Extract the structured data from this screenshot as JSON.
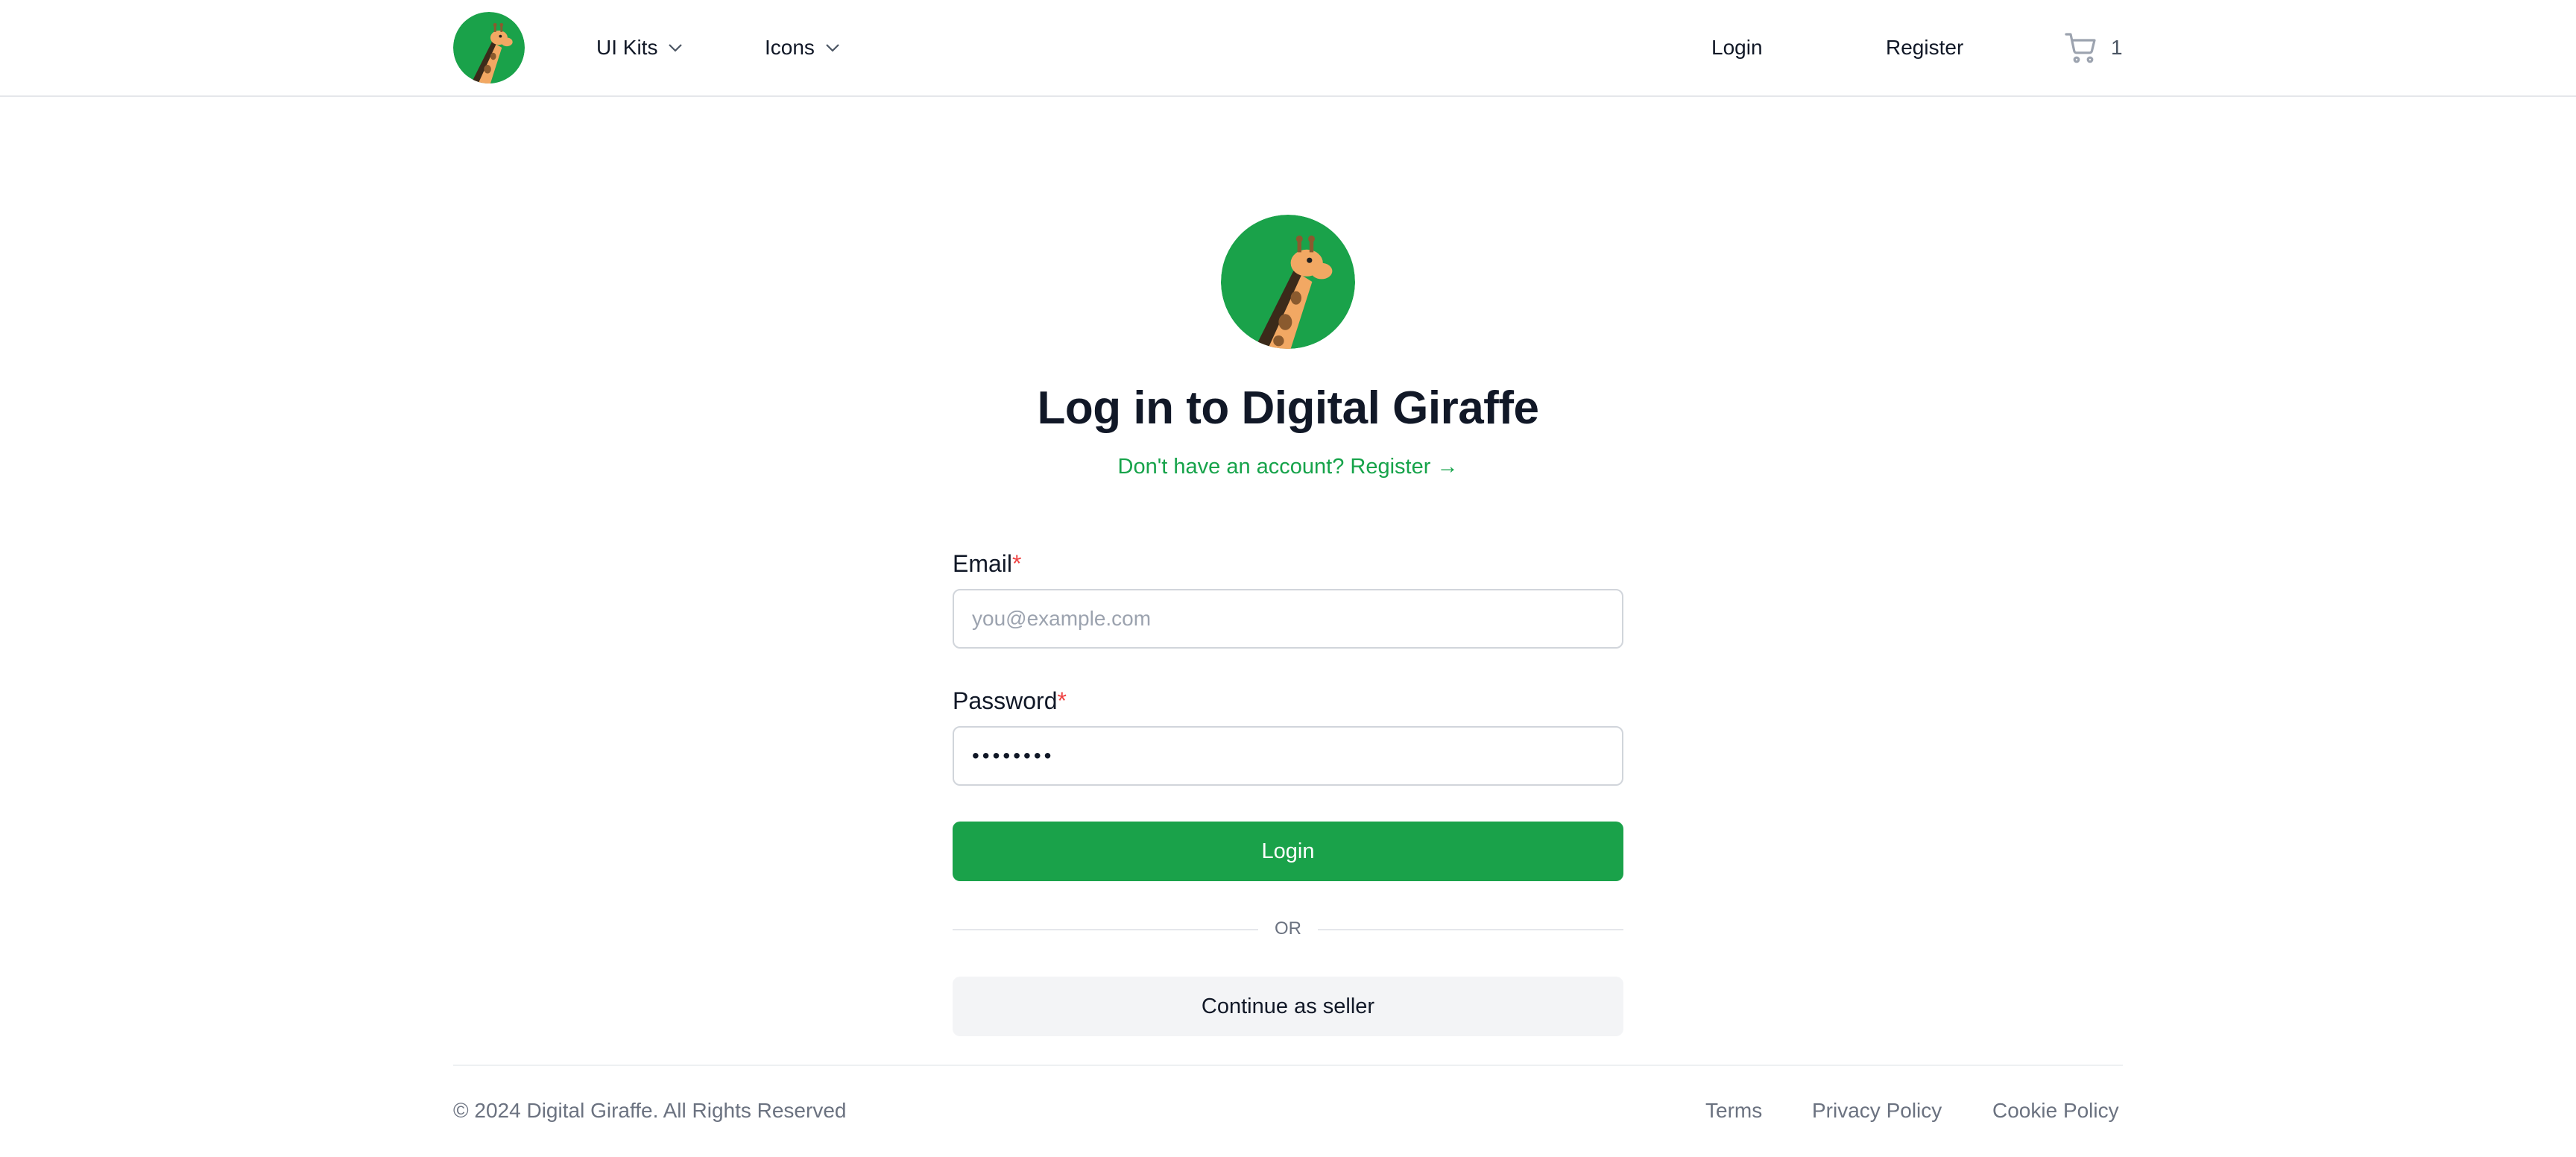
{
  "header": {
    "logo_alt": "Digital Giraffe logo",
    "nav": [
      {
        "label": "UI Kits",
        "icon": "chevron-down-icon"
      },
      {
        "label": "Icons",
        "icon": "chevron-down-icon"
      }
    ],
    "login_label": "Login",
    "register_label": "Register",
    "cart_icon": "cart-icon",
    "cart_count": "1"
  },
  "main": {
    "title": "Log in to Digital Giraffe",
    "register_prompt": "Don't have an account? Register →",
    "email_label": "Email",
    "email_placeholder": "you@example.com",
    "email_value": "",
    "password_label": "Password",
    "password_value": "••••••••",
    "required_marker": "*",
    "login_button": "Login",
    "divider_text": "OR",
    "seller_button": "Continue as seller"
  },
  "footer": {
    "copyright": "© 2024 Digital Giraffe. All Rights Reserved",
    "links": [
      "Terms",
      "Privacy Policy",
      "Cookie Policy"
    ]
  },
  "colors": {
    "brand_green": "#16a34a",
    "button_green": "#1aa24a",
    "required_red": "#ef4444",
    "giraffe_orange": "#f2a863",
    "giraffe_spots": "#8a5a2e"
  }
}
